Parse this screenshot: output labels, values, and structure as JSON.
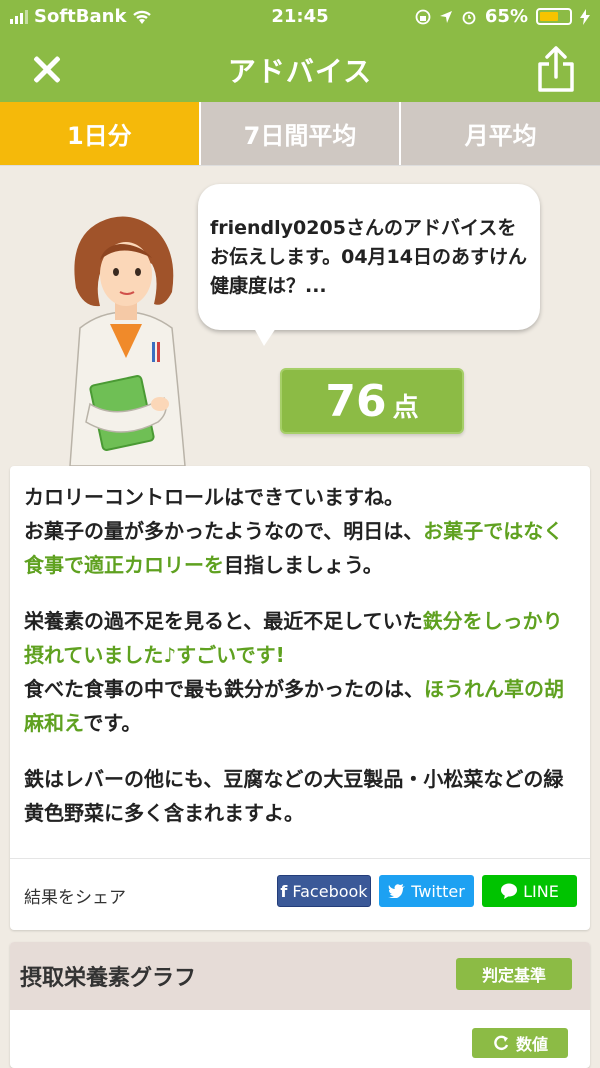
{
  "status_bar": {
    "carrier": "SoftBank",
    "time": "21:45",
    "battery": "65%",
    "battery_level": 0.65
  },
  "header": {
    "title": "アドバイス"
  },
  "tabs": [
    {
      "label": "1日分",
      "active": true
    },
    {
      "label": "7日間平均"
    },
    {
      "label": "月平均"
    }
  ],
  "speech": {
    "text": "friendly0205さんのアドバイスをお伝えします。04月14日のあすけん健康度は？..."
  },
  "score": {
    "value": "76",
    "unit": "点"
  },
  "advice": {
    "p1_a": "カロリーコントロールはできていますね。",
    "p1_b": "お菓子の量が多かったようなので、明日は、",
    "p1_hl": "お菓子ではなく食事で適正カロリーを",
    "p1_c": "目指しましょう。",
    "p2_a": "栄養素の過不足を見ると、最近不足していた",
    "p2_hl": "鉄分をしっかり摂れていました♪すごいです!",
    "p2_b": "食べた食事の中で最も鉄分が多かったのは、",
    "p2_hl2": "ほうれん草の胡麻和え",
    "p2_c": "です。",
    "p3": "鉄はレバーの他にも、豆腐などの大豆製品・小松菜などの緑黄色野菜に多く含まれますよ。"
  },
  "share": {
    "label": "結果をシェア",
    "facebook": "Facebook",
    "twitter": "Twitter",
    "line": "LINE"
  },
  "graph": {
    "title": "摂取栄養素グラフ",
    "judge_button": "判定基準",
    "number_button": "数値"
  },
  "colors": {
    "header_green": "#8cbb45",
    "tab_active": "#f5b90a",
    "highlight": "#5fa120"
  }
}
